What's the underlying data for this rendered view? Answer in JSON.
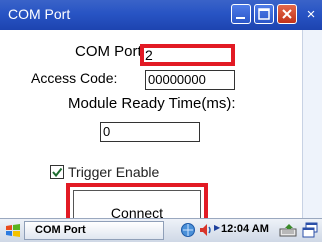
{
  "window": {
    "title": "COM Port",
    "ok_label": "×"
  },
  "form": {
    "com_port_label": "COM Port:",
    "com_port_value": "2",
    "access_code_label": "Access Code:",
    "access_code_value": "00000000",
    "module_ready_label": "Module Ready Time(ms):",
    "module_ready_value": "0",
    "trigger_enable_label": "Trigger Enable",
    "trigger_enable_checked": true,
    "connect_label": "Connect"
  },
  "taskbar": {
    "task_label": "COM Port",
    "clock": "12:04 AM"
  },
  "colors": {
    "highlight": "#e21a24",
    "titlebar": "#2854c4"
  },
  "icons": {
    "start": "windows-start-icon",
    "network": "network-icon",
    "volume": "volume-icon",
    "keyboard": "keyboard-icon",
    "window_switch": "window-switch-icon"
  }
}
